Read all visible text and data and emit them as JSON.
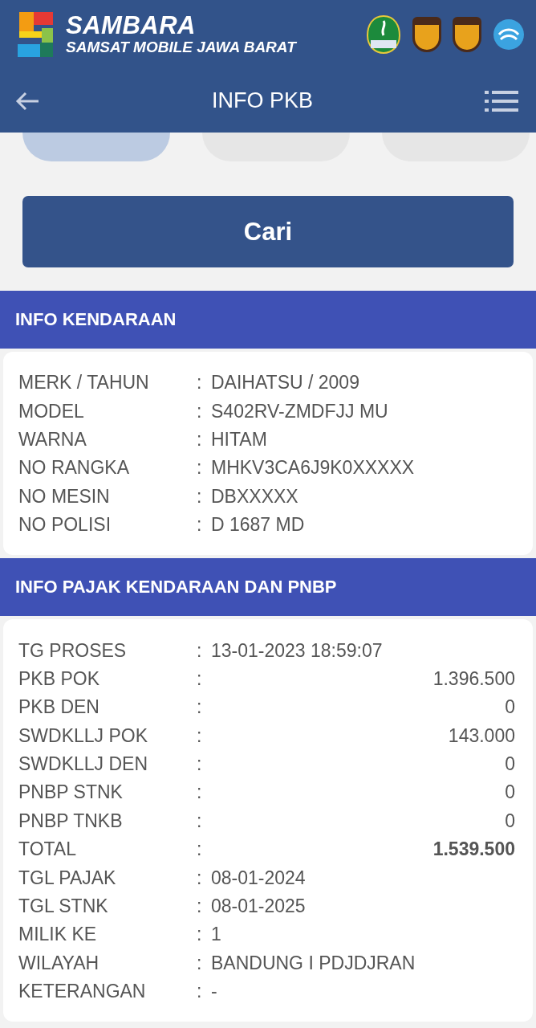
{
  "brand": {
    "title": "SAMBARA",
    "subtitle": "SAMSAT MOBILE JAWA BARAT",
    "emblems": [
      {
        "kind": "province"
      },
      {
        "kind": "shield",
        "color": "#e8a21c"
      },
      {
        "kind": "shield",
        "color": "#e8a21c"
      },
      {
        "kind": "circle"
      }
    ]
  },
  "navbar": {
    "title": "INFO PKB"
  },
  "filter_tabs": [
    {
      "selected": true
    },
    {
      "selected": false
    },
    {
      "selected": false
    }
  ],
  "search_button": "Cari",
  "sections": [
    {
      "title": "INFO KENDARAAN",
      "rows": [
        {
          "label": "MERK / TAHUN",
          "separator": ":",
          "value": "DAIHATSU / 2009",
          "kind": "text"
        },
        {
          "label": "MODEL",
          "separator": ":",
          "value": "S402RV-ZMDFJJ MU",
          "kind": "text"
        },
        {
          "label": "WARNA",
          "separator": ":",
          "value": "HITAM",
          "kind": "text"
        },
        {
          "label": "NO RANGKA",
          "separator": ":",
          "value": "MHKV3CA6J9K0XXXXX",
          "kind": "text"
        },
        {
          "label": "NO MESIN",
          "separator": ":",
          "value": "DBXXXXX",
          "kind": "text"
        },
        {
          "label": "NO POLISI",
          "separator": ":",
          "value": "D 1687 MD",
          "kind": "text"
        }
      ]
    },
    {
      "title": "INFO PAJAK KENDARAAN DAN PNBP",
      "rows": [
        {
          "label": "TG PROSES",
          "separator": ":",
          "value": "13-01-2023 18:59:07",
          "kind": "text"
        },
        {
          "label": "PKB POK",
          "separator": ":",
          "value": "1.396.500",
          "kind": "amount"
        },
        {
          "label": "PKB DEN",
          "separator": ":",
          "value": "0",
          "kind": "amount"
        },
        {
          "label": "SWDKLLJ POK",
          "separator": ":",
          "value": "143.000",
          "kind": "amount"
        },
        {
          "label": "SWDKLLJ DEN",
          "separator": ":",
          "value": "0",
          "kind": "amount"
        },
        {
          "label": "PNBP STNK",
          "separator": ":",
          "value": "0",
          "kind": "amount"
        },
        {
          "label": "PNBP TNKB",
          "separator": ":",
          "value": "0",
          "kind": "amount"
        },
        {
          "label": "TOTAL",
          "separator": ":",
          "value": "1.539.500",
          "kind": "total"
        },
        {
          "label": "TGL PAJAK",
          "separator": ":",
          "value": "08-01-2024",
          "kind": "text"
        },
        {
          "label": "TGL STNK",
          "separator": ":",
          "value": "08-01-2025",
          "kind": "text"
        },
        {
          "label": "MILIK KE",
          "separator": ":",
          "value": "1",
          "kind": "text"
        },
        {
          "label": "WILAYAH",
          "separator": ":",
          "value": "BANDUNG I PDJDJRAN",
          "kind": "text"
        },
        {
          "label": "KETERANGAN",
          "separator": ":",
          "value": "-",
          "kind": "text"
        }
      ]
    }
  ]
}
